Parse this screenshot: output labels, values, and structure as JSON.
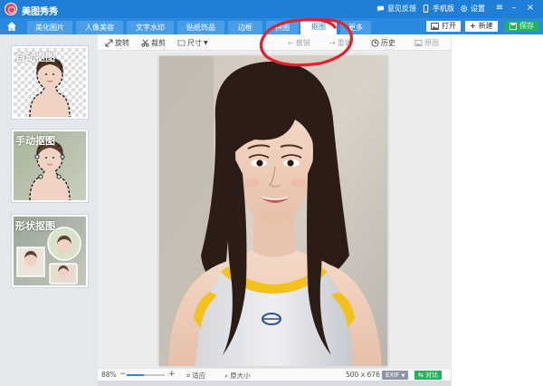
{
  "app": {
    "title": "美图秀秀",
    "feedback": "意见反馈",
    "mobile": "手机版",
    "settings": "设置"
  },
  "tabs": [
    {
      "label": "美化图片"
    },
    {
      "label": "人像美容"
    },
    {
      "label": "文字水印"
    },
    {
      "label": "贴纸饰品"
    },
    {
      "label": "边框"
    },
    {
      "label": "拼图"
    },
    {
      "label": "抠图"
    },
    {
      "label": "更多"
    }
  ],
  "active_tab": "抠图",
  "actions": {
    "open": "打开",
    "new": "新建",
    "save": "保存"
  },
  "toolbar": {
    "rotate": "旋转",
    "crop": "裁剪",
    "size": "尺寸",
    "undo": "撤销",
    "redo": "重做",
    "history": "历史",
    "original": "原图"
  },
  "left_panel": [
    {
      "label": "自动抠图"
    },
    {
      "label": "手动抠图"
    },
    {
      "label": "形状抠图"
    }
  ],
  "status": {
    "zoom": "88%",
    "zoom_level": 0.45,
    "fit": "适应",
    "actual": "原大小",
    "dimensions": "500 x 676",
    "exif": "EXIF",
    "compare": "对比"
  },
  "colors": {
    "titlebar": "#1f7fd6",
    "tabbar": "#2a8ae0",
    "save": "#22b35e",
    "annotation": "#e0222a"
  }
}
